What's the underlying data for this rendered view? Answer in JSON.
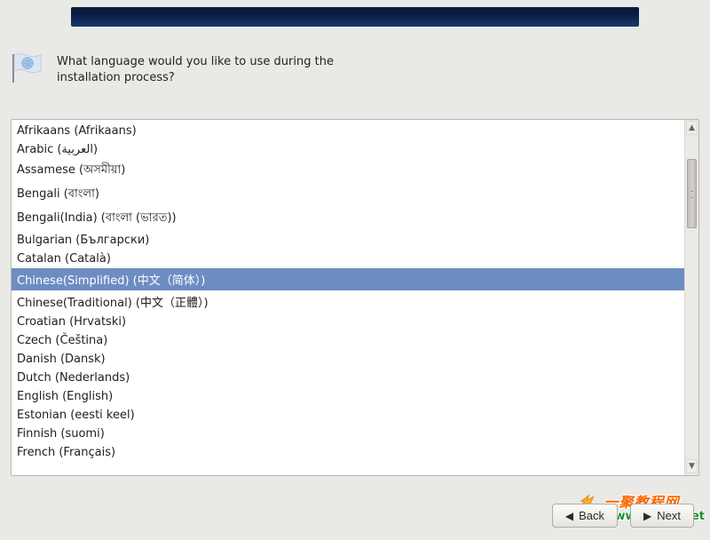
{
  "question": "What language would you like to use during the installation process?",
  "languages": [
    {
      "label": "Afrikaans (Afrikaans)",
      "selected": false
    },
    {
      "label": "Arabic (العربية)",
      "selected": false
    },
    {
      "label": "Assamese (অসমীয়া)",
      "selected": false
    },
    {
      "label": "Bengali (বাংলা)",
      "selected": false
    },
    {
      "label": "Bengali(India) (বাংলা (ভারত))",
      "selected": false
    },
    {
      "label": "Bulgarian (Български)",
      "selected": false
    },
    {
      "label": "Catalan (Català)",
      "selected": false
    },
    {
      "label": "Chinese(Simplified) (中文（简体）)",
      "selected": true
    },
    {
      "label": "Chinese(Traditional) (中文（正體）)",
      "selected": false
    },
    {
      "label": "Croatian (Hrvatski)",
      "selected": false
    },
    {
      "label": "Czech (Čeština)",
      "selected": false
    },
    {
      "label": "Danish (Dansk)",
      "selected": false
    },
    {
      "label": "Dutch (Nederlands)",
      "selected": false
    },
    {
      "label": "English (English)",
      "selected": false
    },
    {
      "label": "Estonian (eesti keel)",
      "selected": false
    },
    {
      "label": "Finnish (suomi)",
      "selected": false
    },
    {
      "label": "French (Français)",
      "selected": false
    }
  ],
  "buttons": {
    "back": "Back",
    "next": "Next"
  },
  "watermark": {
    "cn": "一聚教程网",
    "url": "www.111cn.net"
  }
}
